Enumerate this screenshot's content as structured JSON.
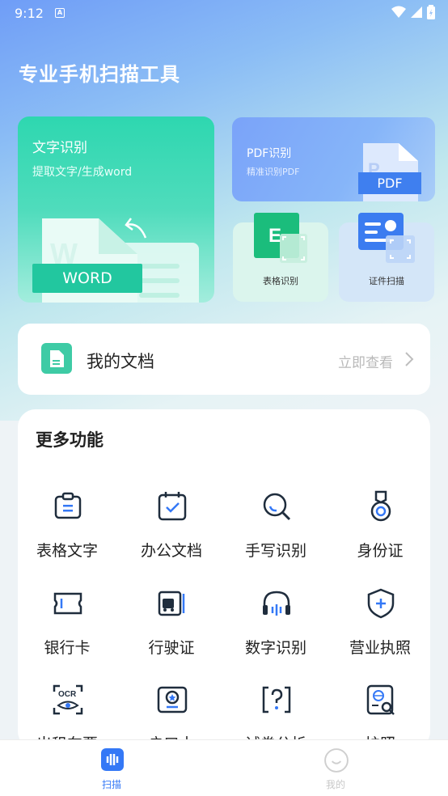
{
  "status_bar": {
    "time": "9:12",
    "notif_icon": "A"
  },
  "header": {
    "title": "专业手机扫描工具"
  },
  "cards": {
    "word": {
      "title": "文字识别",
      "subtitle": "提取文字/生成word",
      "badge": "WORD"
    },
    "pdf": {
      "title": "PDF识别",
      "subtitle": "精准识别PDF",
      "badge": "PDF"
    },
    "table": {
      "label": "表格识别",
      "icon_letter": "E"
    },
    "id_scan": {
      "label": "证件扫描"
    }
  },
  "my_docs": {
    "title": "我的文档",
    "link": "立即查看"
  },
  "more": {
    "title": "更多功能",
    "items": [
      {
        "label": "表格文字",
        "icon": "clipboard-list-icon"
      },
      {
        "label": "办公文档",
        "icon": "calendar-check-icon"
      },
      {
        "label": "手写识别",
        "icon": "magnifier-icon"
      },
      {
        "label": "身份证",
        "icon": "medal-icon"
      },
      {
        "label": "银行卡",
        "icon": "ticket-card-icon"
      },
      {
        "label": "行驶证",
        "icon": "truck-license-icon"
      },
      {
        "label": "数字识别",
        "icon": "headphones-icon"
      },
      {
        "label": "营业执照",
        "icon": "shield-plus-icon"
      },
      {
        "label": "出租车票",
        "icon": "ocr-eye-icon",
        "ocr_text": "OCR"
      },
      {
        "label": "户口本",
        "icon": "certificate-star-icon"
      },
      {
        "label": "试卷分析",
        "icon": "question-frame-icon"
      },
      {
        "label": "护照",
        "icon": "passport-search-icon"
      }
    ]
  },
  "bottom_nav": {
    "scan": {
      "label": "扫描",
      "active": true
    },
    "mine": {
      "label": "我的",
      "active": false
    }
  },
  "colors": {
    "accent_blue": "#3478f6",
    "word_green": "#2ed7b0",
    "pdf_blue": "#7aa3f9",
    "icon_dark": "#1f2d3d",
    "icon_blue": "#3478f6"
  }
}
